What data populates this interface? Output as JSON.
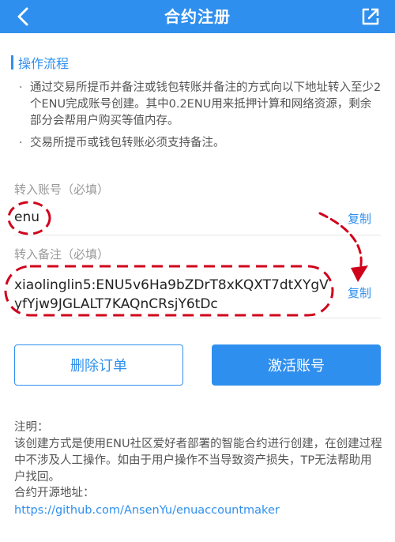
{
  "header": {
    "title": "合约注册",
    "back_icon": "chevron-left-icon",
    "share_icon": "external-link-icon"
  },
  "steps": {
    "title": "操作流程",
    "items": [
      "通过交易所提币并备注或钱包转账并备注的方式向以下地址转入至少2个ENU完成账号创建。其中0.2ENU用来抵押计算和网络资源，剩余部分会帮用户购买等值内存。",
      "交易所提币或钱包转账必须支持备注。"
    ]
  },
  "account": {
    "label": "转入账号（必填）",
    "value": "enu",
    "copy_label": "复制"
  },
  "memo": {
    "label": "转入备注（必填）",
    "value": "xiaolinglin5:ENU5v6Ha9bZDrT8xKQXT7dtXYgVyfYjw9JGLALT7KAQnCRsjY6tDc",
    "copy_label": "复制"
  },
  "buttons": {
    "delete_label": "删除订单",
    "activate_label": "激活账号"
  },
  "note": {
    "title": "注明：",
    "body": "该创建方式是使用ENU社区爱好者部署的智能合约进行创建，在创建过程中不涉及人工操作。如由于用户操作不当导致资产损失，TP无法帮助用户找回。",
    "repo_label": "合约开源地址：",
    "repo_url": "https://github.com/AnsenYu/enuaccountmaker"
  },
  "colors": {
    "primary": "#2f8fee",
    "annotation": "#d0021b"
  }
}
